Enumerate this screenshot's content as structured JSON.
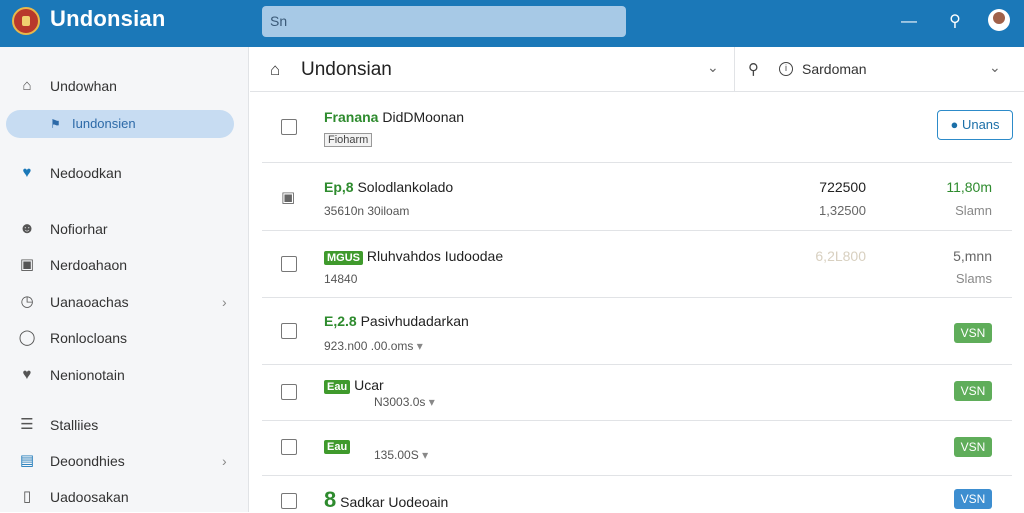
{
  "app": {
    "title": "Undonsian",
    "search_value": "Sn"
  },
  "sidebar": {
    "items": [
      {
        "label": "Undowhan",
        "icon": "home-icon"
      },
      {
        "label": "Iundonsien",
        "icon": "bookmark-icon",
        "active": true
      },
      {
        "label": "Nedoodkan",
        "icon": "heart-icon"
      },
      {
        "label": "Nofiorhar",
        "icon": "users-icon"
      },
      {
        "label": "Nerdoahaon",
        "icon": "calendar-icon"
      },
      {
        "label": "Uanaoachas",
        "icon": "clock-icon"
      },
      {
        "label": "Ronlocloans",
        "icon": "circle-icon"
      },
      {
        "label": "Nenionotain",
        "icon": "heart-icon"
      },
      {
        "label": "Stalliies",
        "icon": "list-icon"
      },
      {
        "label": "Deoondhies",
        "icon": "chat-icon"
      },
      {
        "label": "Uadoosakan",
        "icon": "doc-icon"
      }
    ]
  },
  "main": {
    "title": "Undonsian",
    "filter_label": "Sardoman",
    "rows": [
      {
        "title_green": "Franana",
        "title": "DidDMoonan",
        "sub_tag": "Fioharm",
        "button_label": "Unans"
      },
      {
        "title_green": "Ep,8",
        "title": "Solodlankolado",
        "sub": "35610n 30iloam",
        "amt1": "722500",
        "amt1b": "1,32500",
        "amt2": "11,80m",
        "amt2b": "Slamn"
      },
      {
        "title_green_box": "MGUS",
        "title": "Rluhvahdos Iudoodae",
        "sub": "14840",
        "amt1": "6,2L800",
        "amt2": "5,mnn",
        "amt2b": "Slams"
      },
      {
        "title_green": "E,2.8",
        "title": "Pasivhudadarkan",
        "sub": "923.n00 .00.oms",
        "badge": "VSN"
      },
      {
        "title_green_box": "Eau",
        "title": "Ucar",
        "sub": "N3003.0s",
        "badge": "VSN"
      },
      {
        "title_green_box": "Eau",
        "title": "",
        "sub": "135.00S",
        "badge": "VSN"
      },
      {
        "title_green": "8",
        "title": "Sadkar Uodeoain",
        "sub": "",
        "badge": "VSN"
      }
    ]
  },
  "colors": {
    "topbar": "#1b78b8",
    "green": "#3f9a2c",
    "badge_green": "#5fad5a",
    "badge_blue": "#3d8ed0"
  }
}
